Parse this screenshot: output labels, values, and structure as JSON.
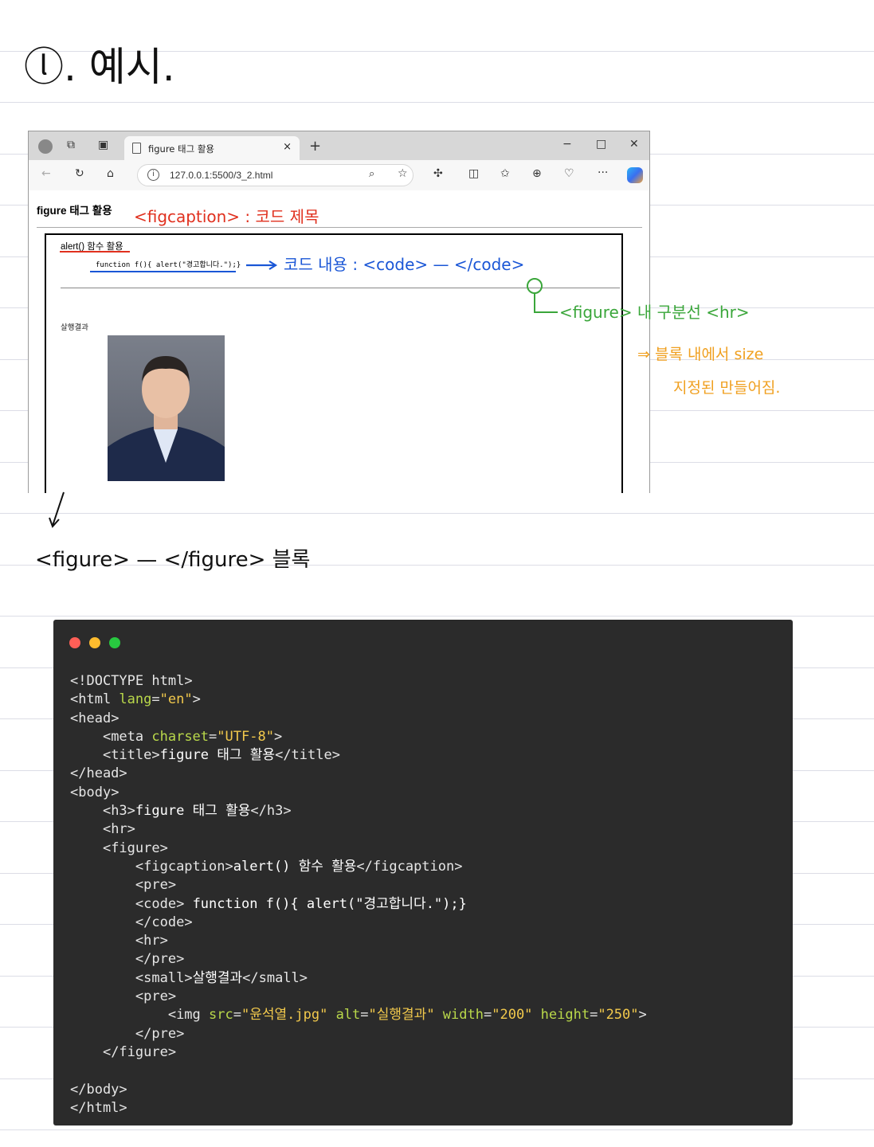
{
  "note": {
    "heading": "ⓛ. 예시.",
    "ann_figcaption": "<figcaption> : 코드 제목",
    "ann_code": "코드 내용 : <code> — </code>",
    "ann_hr_line1": "<figure> 내 구분선 <hr>",
    "ann_hr_line2": "⇒ 블록 내에서 size",
    "ann_hr_line3": "지정된 만들어짐.",
    "ann_figure": "<figure> — </figure> 블록"
  },
  "browser": {
    "tab_title": "figure 태그 활용",
    "tab_close": "×",
    "new_tab": "+",
    "minimize": "−",
    "maximize": "□",
    "close": "✕",
    "url": "127.0.0.1:5500/3_2.html",
    "more": "···",
    "page": {
      "h3": "figure 태그 활용",
      "figcaption": "alert() 함수 활용",
      "code_line": "function f(){ alert(\"경고합니다.\");}",
      "small": "살행결과"
    }
  },
  "code_window": {
    "lines": [
      "<!DOCTYPE html>",
      "<html lang=\"en\">",
      "<head>",
      "    <meta charset=\"UTF-8\">",
      "    <title>figure 태그 활용</title>",
      "</head>",
      "<body>",
      "    <h3>figure 태그 활용</h3>",
      "    <hr>",
      "    <figure>",
      "        <figcaption>alert() 함수 활용</figcaption>",
      "        <pre>",
      "        <code> function f(){ alert(\"경고합니다.\");}",
      "        </code>",
      "        <hr>",
      "        </pre>",
      "        <small>살행결과</small>",
      "        <pre>",
      "            <img src=\"윤석열.jpg\" alt=\"실행결과\" width=\"200\" height=\"250\">",
      "        </pre>",
      "    </figure>",
      "",
      "</body>",
      "</html>"
    ]
  },
  "colors": {
    "red_ink": "#e0301e",
    "blue_ink": "#1a56d6",
    "purple_ink": "#8a1fbf",
    "green_ink": "#3aa63a",
    "orange_ink": "#f0a020",
    "code_bg": "#2b2b2b"
  }
}
